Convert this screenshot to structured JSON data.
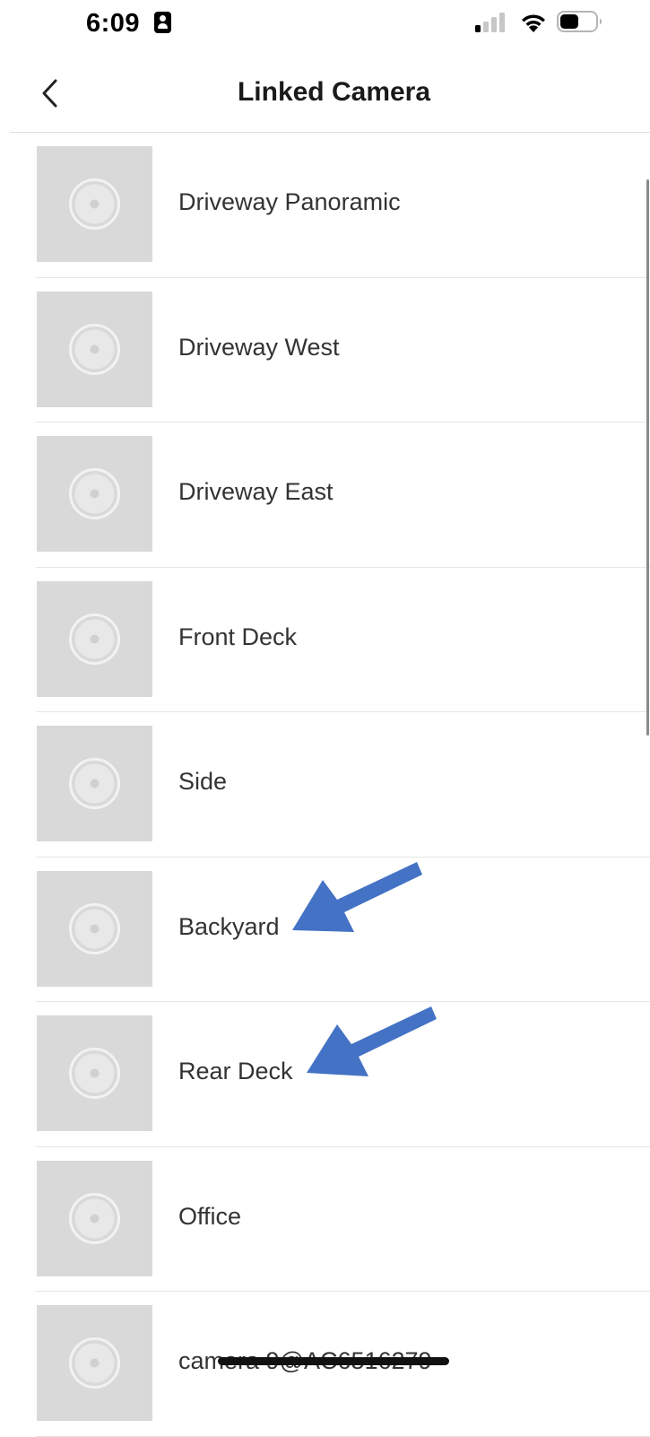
{
  "status_bar": {
    "time": "6:09",
    "focus_icon": "person-badge-icon",
    "signal_icon": "cellular-signal-icon",
    "wifi_icon": "wifi-icon",
    "battery_icon": "battery-icon"
  },
  "header": {
    "title": "Linked Camera",
    "back_icon": "chevron-left-icon"
  },
  "cameras": [
    {
      "name": "Driveway Panoramic"
    },
    {
      "name": "Driveway West"
    },
    {
      "name": "Driveway East"
    },
    {
      "name": "Front Deck"
    },
    {
      "name": "Side"
    },
    {
      "name": "Backyard"
    },
    {
      "name": "Rear Deck"
    },
    {
      "name": "Office"
    },
    {
      "name": "camera 9@AC6516279"
    }
  ],
  "camera_placeholder_icon": "camera-placeholder-icon",
  "annotations": {
    "arrow_color": "#4472C4",
    "arrows_point_to": [
      "Backyard",
      "Rear Deck"
    ]
  },
  "colors": {
    "thumbnail_bg": "#d9d9d9",
    "divider": "#e6e6e6",
    "text": "#333333"
  }
}
